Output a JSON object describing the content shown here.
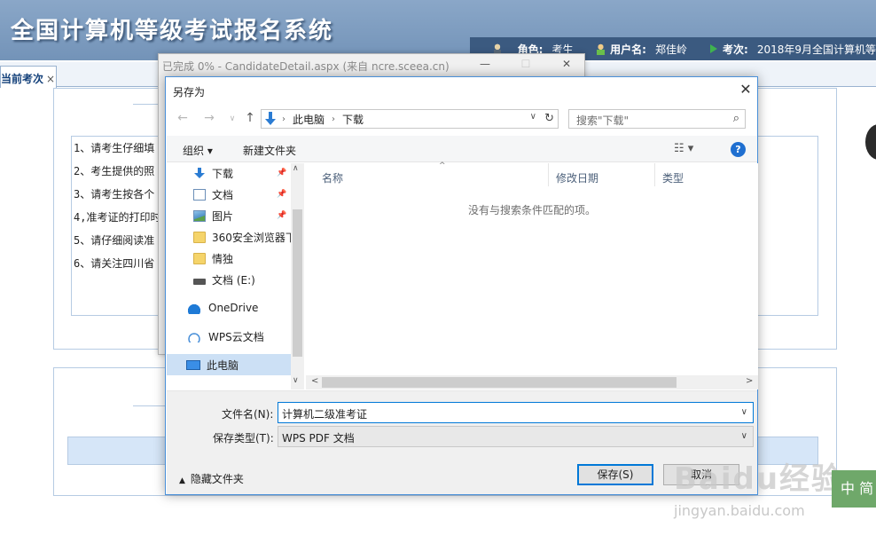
{
  "page": {
    "title": "全国计算机等级考试报名系统",
    "info": {
      "role_label": "角色:",
      "role_value": "考生",
      "user_label": "用户名:",
      "user_value": "郑佳岭",
      "exam_label": "考次:",
      "exam_value": "2018年9月全国计算机等"
    },
    "tab": {
      "label": "当前考次",
      "close": "×"
    },
    "notices": [
      "1、请考生仔细填",
      "2、考生提供的照",
      "3、请考生按各个",
      "4,准考证的打印时",
      "5、请仔细阅读准",
      "6、请关注四川省"
    ]
  },
  "progress_window": {
    "title": "已完成 0% - CandidateDetail.aspx (来自 ncre.sceea.cn)",
    "min": "—",
    "max": "☐",
    "close": "✕"
  },
  "dialog": {
    "title": "另存为",
    "close": "✕",
    "nav": {
      "back": "←",
      "forward": "→",
      "dropdown": "∨",
      "up": "↑"
    },
    "address": {
      "crumbs": [
        "此电脑",
        "下载"
      ],
      "separator": "›",
      "dropdown": "∨",
      "refresh": "↻"
    },
    "search": {
      "placeholder": "搜索\"下载\"",
      "icon": "⌕"
    },
    "toolbar": {
      "organize": "组织 ▾",
      "new_folder": "新建文件夹",
      "view": "☷ ▾",
      "help": "?"
    },
    "nav_pane": [
      {
        "label": "下载",
        "icon": "download-icon",
        "pinned": true
      },
      {
        "label": "文档",
        "icon": "document-icon",
        "pinned": true
      },
      {
        "label": "图片",
        "icon": "picture-icon",
        "pinned": true
      },
      {
        "label": "360安全浏览器下",
        "icon": "folder-icon",
        "pinned": false
      },
      {
        "label": "情独",
        "icon": "folder-icon",
        "pinned": false
      },
      {
        "label": "文档 (E:)",
        "icon": "drive-icon",
        "pinned": false
      },
      {
        "label": "OneDrive",
        "icon": "onedrive-icon",
        "pinned": false
      },
      {
        "label": "WPS云文档",
        "icon": "wps-cloud-icon",
        "pinned": false
      },
      {
        "label": "此电脑",
        "icon": "computer-icon",
        "pinned": false,
        "selected": true
      }
    ],
    "pin_glyph": "📌",
    "columns": {
      "name": "名称",
      "date": "修改日期",
      "type": "类型",
      "sort_caret": "^"
    },
    "empty_message": "没有与搜索条件匹配的项。",
    "scroll": {
      "up": "∧",
      "down": "∨",
      "left": "<",
      "right": ">"
    },
    "filename_label": "文件名(N):",
    "filename_value": "计算机二级准考证",
    "filetype_label": "保存类型(T):",
    "filetype_value": "WPS PDF 文档",
    "dropdown_glyph": "∨",
    "hide_folders_caret": "▲",
    "hide_folders": "隐藏文件夹",
    "save_button": "保存(S)",
    "cancel_button": "取消"
  },
  "watermark": {
    "text": "Baidu经验",
    "url": "jingyan.baidu.com",
    "lang": "中 简"
  }
}
